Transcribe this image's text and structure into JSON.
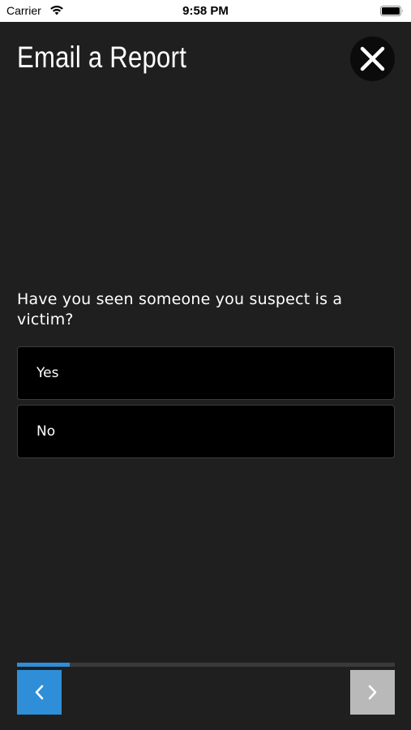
{
  "status_bar": {
    "carrier": "Carrier",
    "time": "9:58 PM",
    "icons": [
      "wifi-icon",
      "battery-icon"
    ]
  },
  "header": {
    "title": "Email a Report",
    "close_icon": "close-icon"
  },
  "question": {
    "text": "Have you seen someone you suspect is a victim?",
    "options": [
      {
        "label": "Yes"
      },
      {
        "label": "No"
      }
    ]
  },
  "progress": {
    "fraction": 0.14
  },
  "navigation": {
    "back_icon": "chevron-left-icon",
    "next_icon": "chevron-right-icon",
    "back_enabled": true,
    "next_enabled": false
  },
  "colors": {
    "background": "#1f1f1f",
    "accent": "#2e8fd8",
    "option_background": "#000000",
    "disabled_button": "#b9b9b9"
  }
}
